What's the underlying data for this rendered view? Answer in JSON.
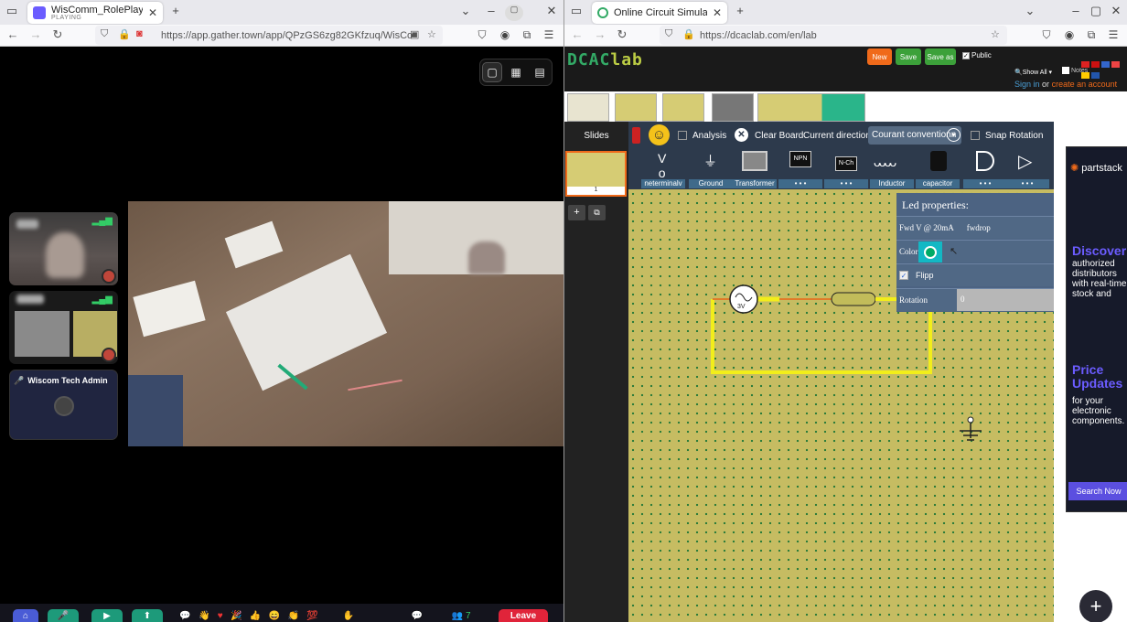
{
  "left_window": {
    "tab": {
      "title": "WisComm_RolePlay_Wor",
      "status": "PLAYING"
    },
    "url": "https://app.gather.town/app/QPzGS6zg82GKfzuq/WisCo",
    "participants": [
      {
        "name": ""
      },
      {
        "name": ""
      },
      {
        "name": "Wiscom Tech Admin"
      }
    ],
    "leave_label": "Leave",
    "people_count": "7"
  },
  "right_window": {
    "tab": {
      "title": "Online Circuit Simulator |"
    },
    "url": "https://dcaclab.com/en/lab",
    "header": {
      "logo_dcac": "DCAC",
      "logo_lab": "lab",
      "new_label": "New",
      "save_label": "Save",
      "saveas_label": "Save as",
      "public_label": "Public",
      "showall_label": "Show All",
      "notes_label": "Notes",
      "signin_label": "Sign in",
      "or_label": "or",
      "create_label": "create an account"
    },
    "slides_label": "Slides",
    "slide_number": "1",
    "toolbar": {
      "analysis": "Analysis",
      "clear": "Clear Board",
      "current_direction": "Current direction:",
      "current_value": "Courant conventionn",
      "snap": "Snap Rotation"
    },
    "palette": [
      "neterminalv",
      "Ground",
      "Transformer",
      "NPN",
      "N-Ch",
      "Inductor",
      "capacitor",
      "",
      ""
    ],
    "palette_more": "• • •",
    "led_props": {
      "title": "Led properties:",
      "fwd_label": "Fwd V @ 20mA",
      "fwd_value": "fwdrop",
      "color_label": "Color",
      "flipp_label": "Flipp",
      "rotation_label": "Rotation",
      "rotation_value": "0"
    },
    "source_label": "3V",
    "ad": {
      "brand": "partstack",
      "discover_title": "Discover",
      "discover_text": "authorized distributors with real-time stock and",
      "price_title": "Price Updates",
      "price_text": "for your electronic components.",
      "cta": "Search Now"
    }
  }
}
